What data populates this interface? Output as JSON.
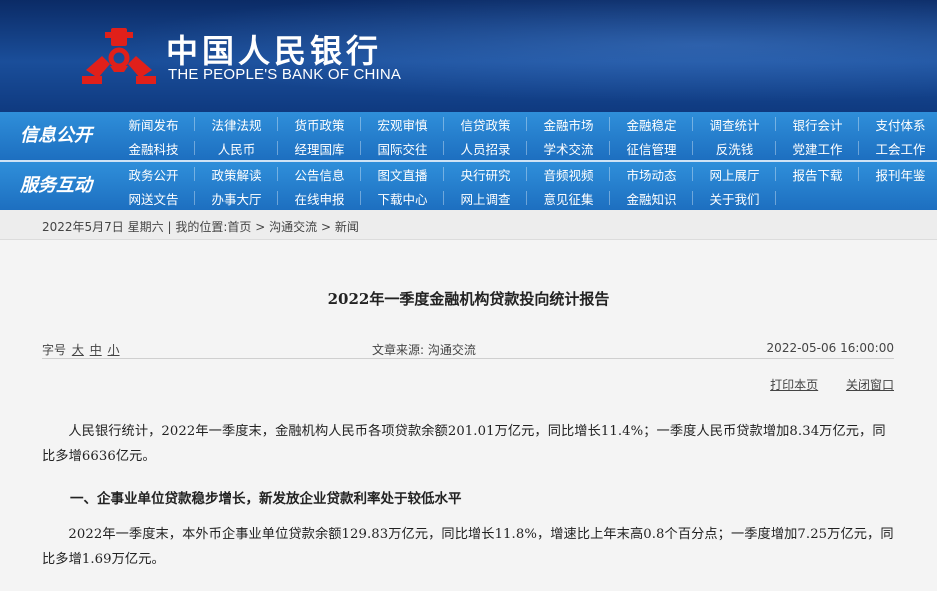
{
  "header": {
    "title_cn": "中国人民银行",
    "title_en": "THE PEOPLE'S BANK OF CHINA",
    "logo_color": "#e0201a",
    "bg_color": "#123f86"
  },
  "nav": {
    "section1_label": "信息公开",
    "section2_label": "服务互动",
    "row1": [
      "新闻发布",
      "法律法规",
      "货币政策",
      "宏观审慎",
      "信贷政策",
      "金融市场",
      "金融稳定",
      "调查统计",
      "银行会计",
      "支付体系"
    ],
    "row2": [
      "金融科技",
      "人民币",
      "经理国库",
      "国际交往",
      "人员招录",
      "学术交流",
      "征信管理",
      "反洗钱",
      "党建工作",
      "工会工作"
    ],
    "row3": [
      "政务公开",
      "政策解读",
      "公告信息",
      "图文直播",
      "央行研究",
      "音频视频",
      "市场动态",
      "网上展厅",
      "报告下载",
      "报刊年鉴"
    ],
    "row4": [
      "网送文告",
      "办事大厅",
      "在线申报",
      "下载中心",
      "网上调查",
      "意见征集",
      "金融知识",
      "关于我们"
    ]
  },
  "breadcrumb": {
    "date": "2022年5月7日 星期六",
    "separator": "|",
    "location_label": "我的位置:",
    "items": [
      "首页",
      "沟通交流",
      "新闻"
    ],
    "arrow": ">"
  },
  "article": {
    "title": "2022年一季度金融机构贷款投向统计报告",
    "font_size_label": "字号",
    "font_sizes": [
      "大",
      "中",
      "小"
    ],
    "source": "文章来源:  沟通交流",
    "date": "2022-05-06 16:00:00",
    "print_label": "打印本页",
    "close_label": "关闭窗口",
    "para1": "人民银行统计，2022年一季度末，金融机构人民币各项贷款余额201.01万亿元，同比增长11.4%；一季度人民币贷款增加8.34万亿元，同比多增6636亿元。",
    "heading1": "一、企事业单位贷款稳步增长，新发放企业贷款利率处于较低水平",
    "para2": "2022年一季度末，本外币企事业单位贷款余额129.83万亿元，同比增长11.8%，增速比上年末高0.8个百分点；一季度增加7.25万亿元，同比多增1.69万亿元。"
  }
}
